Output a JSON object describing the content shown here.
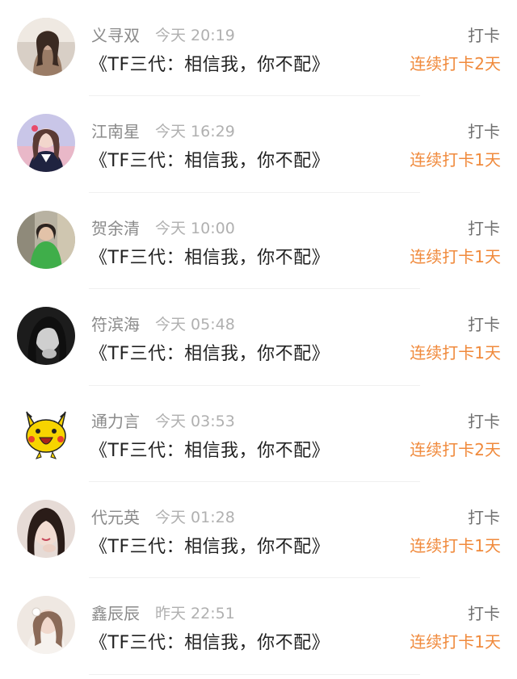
{
  "colors": {
    "name": "#8a8a8a",
    "time": "#b0b0b0",
    "title": "#222222",
    "checkin": "#707070",
    "streak": "#f08a3c"
  },
  "rows": [
    {
      "name": "义寻双",
      "time": "今天 20:19",
      "title": "《TF三代：相信我，你不配》",
      "checkin": "打卡",
      "streak": "连续打卡2天",
      "avatar_icon": "user-avatar-photo"
    },
    {
      "name": "江南星",
      "time": "今天 16:29",
      "title": "《TF三代：相信我，你不配》",
      "checkin": "打卡",
      "streak": "连续打卡1天",
      "avatar_icon": "user-avatar-photo"
    },
    {
      "name": "贺余清",
      "time": "今天 10:00",
      "title": "《TF三代：相信我，你不配》",
      "checkin": "打卡",
      "streak": "连续打卡1天",
      "avatar_icon": "user-avatar-photo"
    },
    {
      "name": "符滨海",
      "time": "今天 05:48",
      "title": "《TF三代：相信我，你不配》",
      "checkin": "打卡",
      "streak": "连续打卡1天",
      "avatar_icon": "user-avatar-photo"
    },
    {
      "name": "通力言",
      "time": "今天 03:53",
      "title": "《TF三代：相信我，你不配》",
      "checkin": "打卡",
      "streak": "连续打卡2天",
      "avatar_icon": "pikachu-avatar"
    },
    {
      "name": "代元英",
      "time": "今天 01:28",
      "title": "《TF三代：相信我，你不配》",
      "checkin": "打卡",
      "streak": "连续打卡1天",
      "avatar_icon": "user-avatar-photo"
    },
    {
      "name": "鑫辰辰",
      "time": "昨天 22:51",
      "title": "《TF三代：相信我，你不配》",
      "checkin": "打卡",
      "streak": "连续打卡1天",
      "avatar_icon": "user-avatar-photo"
    }
  ]
}
